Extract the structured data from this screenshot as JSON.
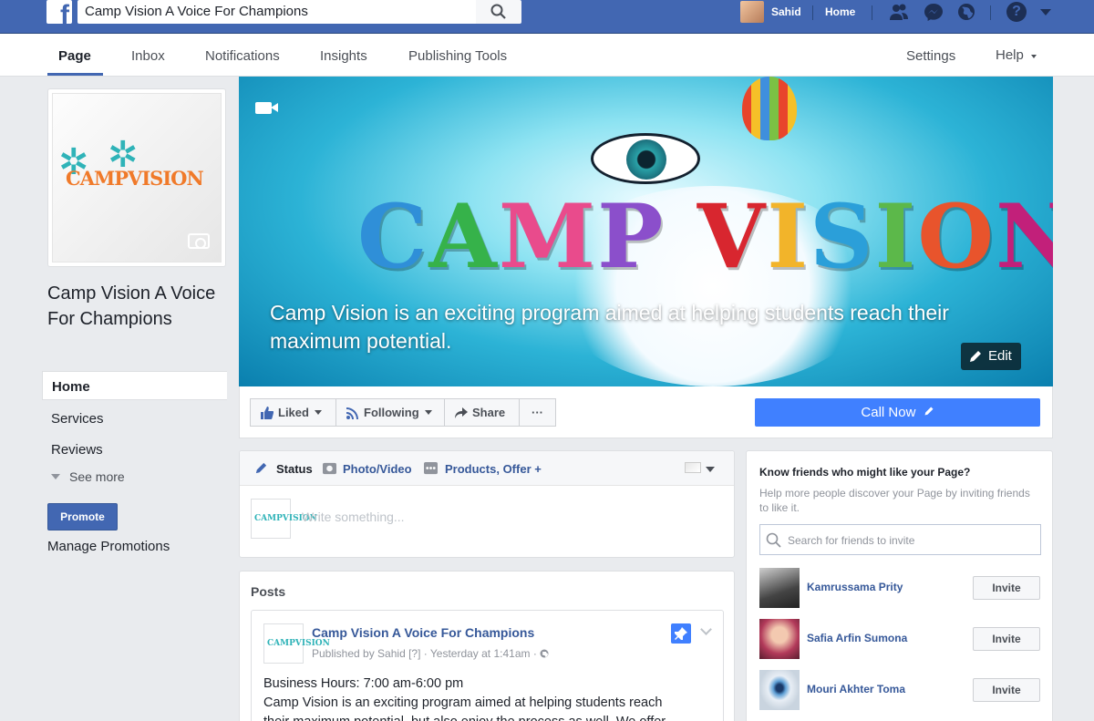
{
  "topbar": {
    "search_value": "Camp Vision A Voice For Champions",
    "user_name": "Sahid",
    "home_label": "Home",
    "help_glyph": "?"
  },
  "page_nav": {
    "tabs": [
      "Page",
      "Inbox",
      "Notifications",
      "Insights",
      "Publishing Tools"
    ],
    "settings_label": "Settings",
    "help_label": "Help"
  },
  "left": {
    "page_name": "Camp Vision A Voice For Champions",
    "logo_text": "CAMPVISION",
    "nav": [
      "Home",
      "Services",
      "Reviews"
    ],
    "see_more": "See more",
    "promote_label": "Promote",
    "manage_promotions": "Manage Promotions"
  },
  "cover": {
    "title_letters": [
      "C",
      "A",
      "M",
      "P",
      " ",
      "V",
      "I",
      "S",
      "I",
      "O",
      "N"
    ],
    "title_colors": [
      "#2f8fd8",
      "#36b24a",
      "#e94b8c",
      "#8b4fcb",
      "#ffffff",
      "#d8262f",
      "#f2b42a",
      "#2b9fd9",
      "#5cb84a",
      "#e8542c",
      "#c2207a"
    ],
    "description": "Camp Vision is an exciting program aimed at helping students reach their maximum potential.",
    "edit_label": "Edit"
  },
  "actions": {
    "liked": "Liked",
    "following": "Following",
    "share": "Share",
    "more": "···",
    "call_now": "Call Now"
  },
  "composer": {
    "tab_status": "Status",
    "tab_photo": "Photo/Video",
    "tab_products": "Products, Offer +",
    "placeholder": "Write something..."
  },
  "posts": {
    "title": "Posts",
    "author": "Camp Vision A Voice For Champions",
    "meta": "Published by Sahid [?] · Yesterday at 1:41am · ",
    "line1": "Business Hours: 7:00 am-6:00 pm",
    "line2": "Camp Vision is an exciting program aimed at helping students reach",
    "line3": "their maximum potential, but also enjoy the process as well. We offer"
  },
  "invite": {
    "title": "Know friends who might like your Page?",
    "subtitle": "Help more people discover your Page by inviting friends to like it.",
    "search_placeholder": "Search for friends to invite",
    "button_label": "Invite",
    "friends": [
      "Kamrussama Prity",
      "Safia Arfin Sumona",
      "Mouri Akhter Toma"
    ]
  },
  "colors": {
    "fb_blue": "#4267b2",
    "link_blue": "#365899",
    "call_blue": "#4080ff"
  }
}
